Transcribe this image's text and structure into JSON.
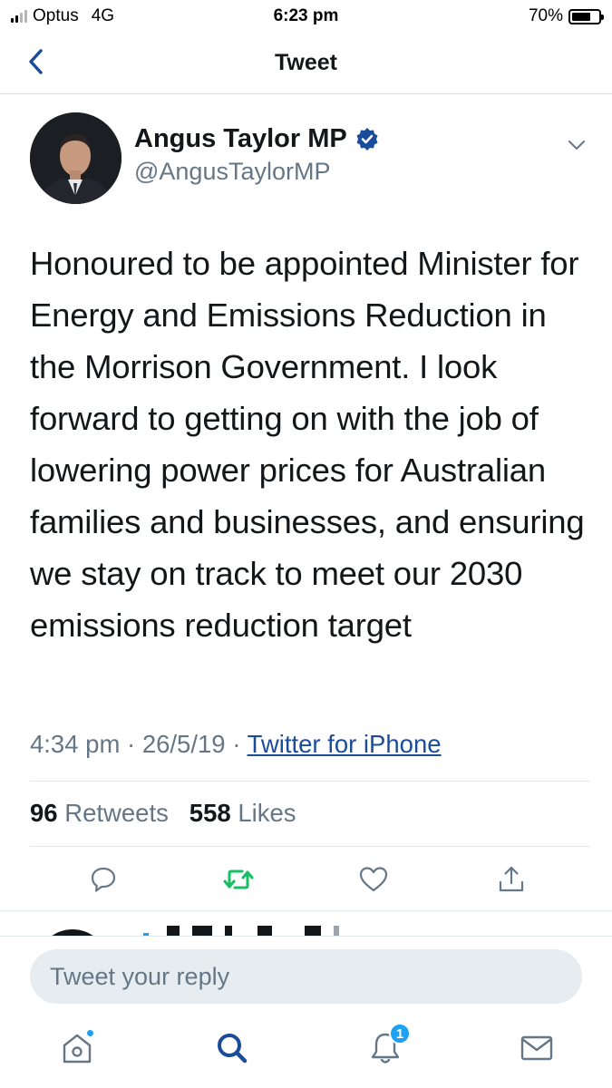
{
  "status_bar": {
    "carrier": "Optus",
    "network": "4G",
    "time": "6:23 pm",
    "battery_text": "70%",
    "battery_level": 0.7
  },
  "header": {
    "title": "Tweet",
    "back_icon": "chevron-left-icon"
  },
  "tweet": {
    "author_name": "Angus Taylor MP",
    "verified": true,
    "handle": "@AngusTaylorMP",
    "text": "Honoured to be appointed Minister for Energy and Emissions Reduction in the Morrison Government. I look forward to getting on with the job of lowering power prices for Australian families and businesses, and ensuring we stay on track to meet our 2030 emissions reduction target",
    "time": "4:34 pm",
    "date": "26/5/19",
    "separator": "·",
    "source": "Twitter for iPhone",
    "retweets_count": "96",
    "retweets_label": "Retweets",
    "likes_count": "558",
    "likes_label": "Likes"
  },
  "actions": [
    {
      "icon": "reply-icon"
    },
    {
      "icon": "retweet-icon",
      "color": "#17bf63"
    },
    {
      "icon": "heart-icon"
    },
    {
      "icon": "share-icon"
    }
  ],
  "reply": {
    "placeholder": "Tweet your reply"
  },
  "tab_bar": {
    "notifications_badge": "1",
    "accent": "#1da1f2",
    "active_color": "#1b4c9a"
  }
}
